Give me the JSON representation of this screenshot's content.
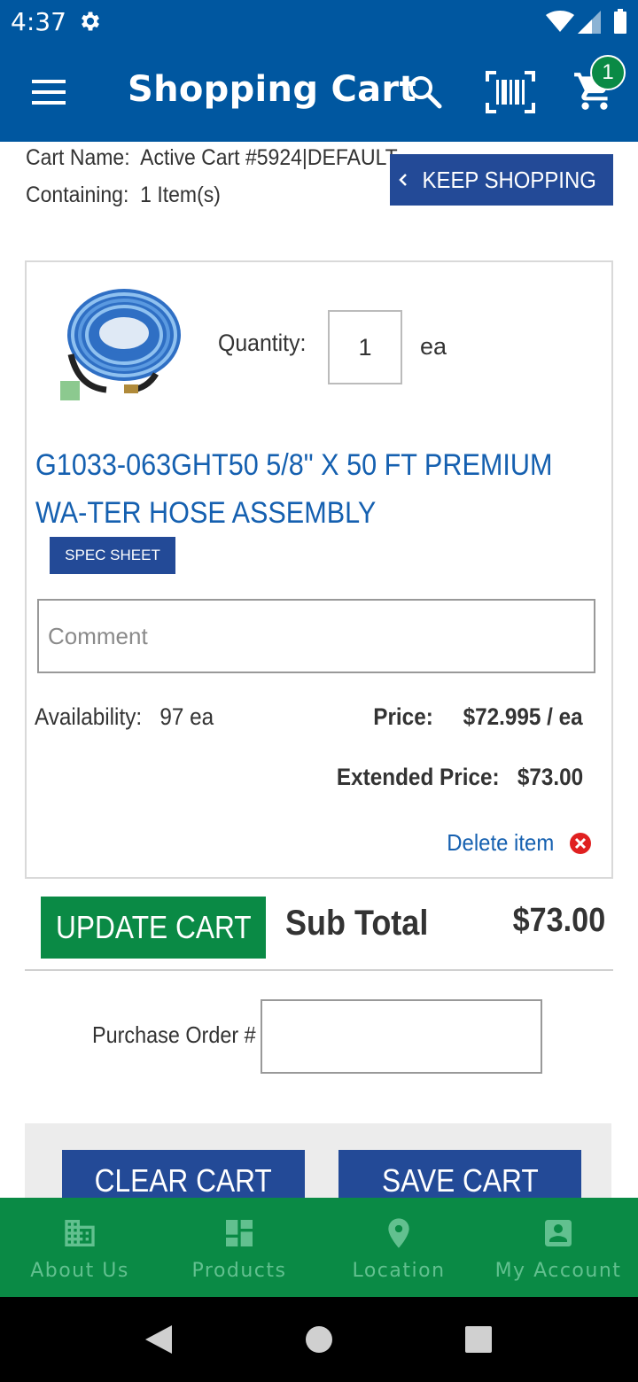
{
  "status_bar": {
    "time": "4:37"
  },
  "app_bar": {
    "title": "Shopping Cart",
    "cart_count": "1"
  },
  "cart_info": {
    "name_label": "Cart Name:",
    "name_value": "Active Cart #5924|DEFAULT",
    "containing_label": "Containing:",
    "containing_value": "1 Item(s)",
    "keep_shopping": "KEEP SHOPPING"
  },
  "item": {
    "quantity_label": "Quantity:",
    "quantity_value": "1",
    "quantity_unit": "ea",
    "title": "G1033-063GHT50 5/8\" X 50 FT PREMIUM WA-TER HOSE ASSEMBLY",
    "spec_sheet": "SPEC SHEET",
    "comment_placeholder": "Comment",
    "availability_label": "Availability:",
    "availability_value": "97 ea",
    "price_label": "Price:",
    "price_value": "$72.995 / ea",
    "extended_price_label": "Extended Price:",
    "extended_price_value": "$73.00",
    "delete_label": "Delete item"
  },
  "totals": {
    "update_cart": "UPDATE CART",
    "subtotal_label": "Sub Total",
    "subtotal_value": "$73.00"
  },
  "purchase_order": {
    "label": "Purchase Order #",
    "value": ""
  },
  "actions": {
    "clear_cart": "CLEAR CART",
    "save_cart": "SAVE CART"
  },
  "bottom_nav": [
    {
      "label": "About Us",
      "icon": "building-icon"
    },
    {
      "label": "Products",
      "icon": "dashboard-icon"
    },
    {
      "label": "Location",
      "icon": "location-pin-icon"
    },
    {
      "label": "My Account",
      "icon": "account-box-icon"
    }
  ],
  "colors": {
    "primary_blue": "#0057a0",
    "button_blue": "#234a97",
    "link_blue": "#1560b0",
    "green": "#0a8a45",
    "nav_icon": "#62c08f"
  }
}
